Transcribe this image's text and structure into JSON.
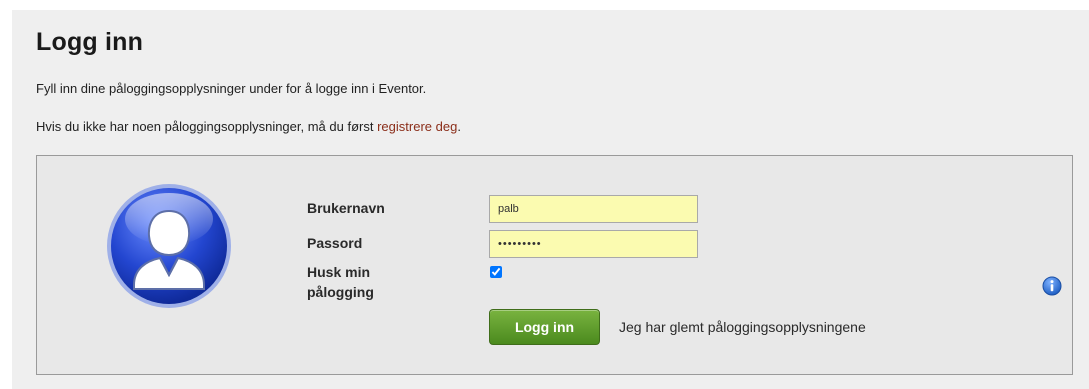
{
  "page": {
    "title": "Logg inn",
    "intro_line1": "Fyll inn dine påloggingsopplysninger under for å logge inn i Eventor.",
    "intro_line2_prefix": "Hvis du ikke har noen påloggingsopplysninger, må du først ",
    "intro_line2_link": "registrere deg",
    "intro_line2_suffix": "."
  },
  "form": {
    "username_label": "Brukernavn",
    "username_value": "palb",
    "password_label": "Passord",
    "password_value": "•••••••••",
    "remember_label": "Husk min pålogging",
    "remember_checked": true,
    "submit_label": "Logg inn",
    "forgot_link": "Jeg har glemt påloggingsopplysningene"
  },
  "icons": {
    "avatar": "user-avatar-icon",
    "info": "info-icon"
  },
  "colors": {
    "panel_bg": "#efefef",
    "input_bg": "#fbfbb0",
    "button_green": "#5b9a28",
    "link_red": "#8b2e1a",
    "avatar_blue": "#2a4fd8",
    "info_blue": "#2b74d6"
  }
}
